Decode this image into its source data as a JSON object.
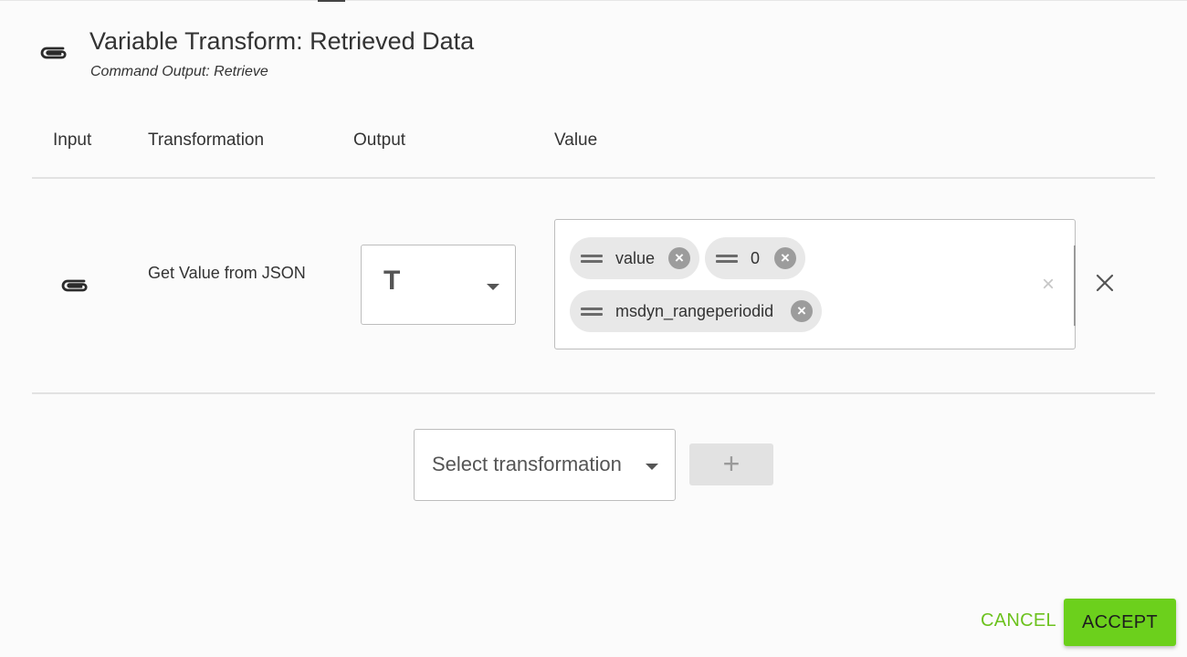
{
  "dialog": {
    "title": "Variable Transform: Retrieved Data",
    "subtitle": "Command Output: Retrieve",
    "icon": "paperclip-icon"
  },
  "columns": {
    "input": "Input",
    "transformation": "Transformation",
    "output": "Output",
    "value": "Value"
  },
  "row": {
    "input_icon": "paperclip-icon",
    "transformation": "Get Value from JSON",
    "output_type_glyph": "T",
    "value_chips": [
      {
        "label": "value"
      },
      {
        "label": "0"
      },
      {
        "label": "msdyn_rangeperiodid"
      }
    ],
    "clear_all_glyph": "×"
  },
  "add_transformation": {
    "placeholder": "Select transformation",
    "add_glyph": "+"
  },
  "footer": {
    "cancel_label": "CANCEL",
    "accept_label": "ACCEPT"
  },
  "colors": {
    "accent": "#6cd01c",
    "accent_text": "#6cc21e",
    "chip_bg": "#e8e8e8"
  }
}
